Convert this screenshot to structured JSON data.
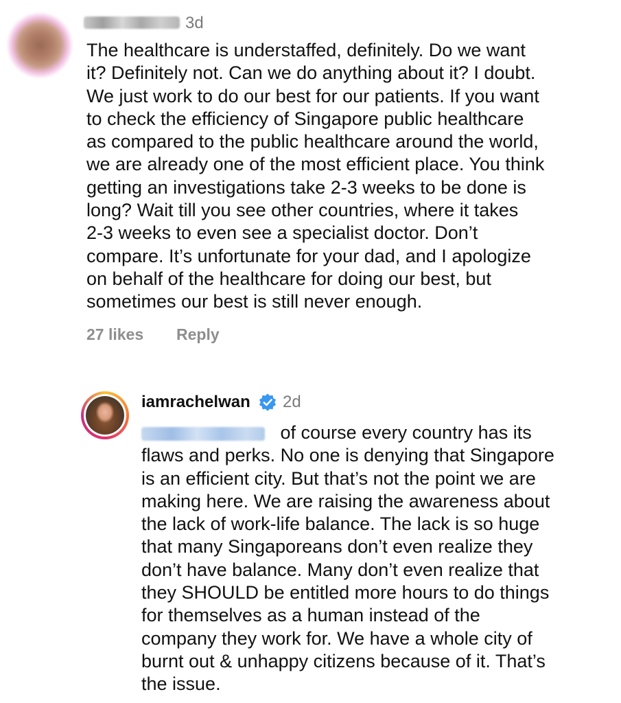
{
  "comments": [
    {
      "time": "3d",
      "text": "The healthcare is understaffed, definitely. Do we want\nit? Definitely not. Can we do anything about it? I doubt.\nWe just work to do our best for our patients. If you want\nto check the efficiency of Singapore public healthcare\nas compared to the public healthcare around the world,\nwe are already one of the most efficient place. You think\ngetting an investigations take 2-3 weeks to be done is\nlong? Wait till you see other countries, where it takes\n2-3 weeks to even see a specialist doctor. Don’t\ncompare. It’s unfortunate for your dad, and I apologize\non behalf of the healthcare for doing our best, but\nsometimes our best is still never enough.",
      "likes": "27 likes",
      "reply_label": "Reply"
    },
    {
      "username": "iamrachelwan",
      "verified": true,
      "time": "2d",
      "text": "                           of course every country has its\nflaws and perks. No one is denying that Singapore\nis an efficient city. But that’s not the point we are\nmaking here. We are raising the awareness about\nthe lack of work-life balance. The lack is so huge\nthat many Singaporeans don’t even realize they\ndon’t have balance. Many don’t even realize that\nthey SHOULD be entitled more hours to do things\nfor themselves as a human instead of the\ncompany they work for. We have a whole city of\nburnt out & unhappy citizens because of it. That’s\nthe issue."
    }
  ],
  "icons": {
    "verified": "verified-badge-icon"
  },
  "colors": {
    "verified_blue": "#3897f0",
    "meta_gray": "#8e8e8e",
    "time_gray": "#7a7a7a",
    "text": "#111111"
  }
}
